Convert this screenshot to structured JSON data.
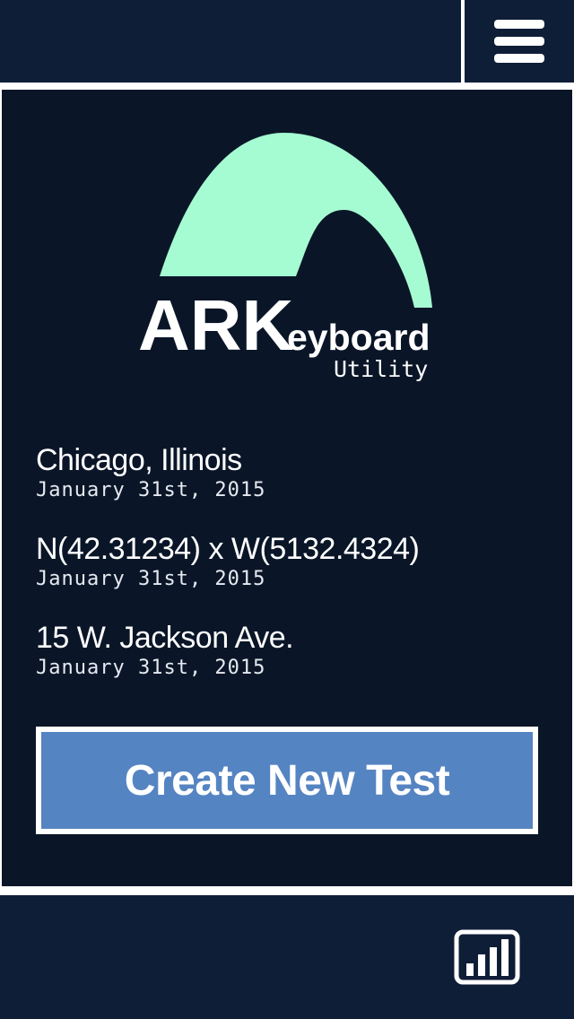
{
  "header": {
    "menu_icon": "hamburger-menu-icon"
  },
  "logo": {
    "wordmark_main": "ARK",
    "wordmark_rest": "eyboard",
    "subtitle": "Utility",
    "arch_color": "#a6fcd2"
  },
  "locations": [
    {
      "title": "Chicago, Illinois",
      "date": "January 31st, 2015"
    },
    {
      "title": "N(42.31234) x W(5132.4324)",
      "date": "January 31st, 2015"
    },
    {
      "title": "15 W. Jackson Ave.",
      "date": "January 31st, 2015"
    }
  ],
  "actions": {
    "create_label": "Create New Test"
  },
  "footer": {
    "stats_icon": "bar-chart-icon"
  },
  "colors": {
    "bar_background": "#0f1e37",
    "main_background": "#0a1628",
    "button_blue": "#5584c2",
    "accent_mint": "#a6fcd2"
  }
}
